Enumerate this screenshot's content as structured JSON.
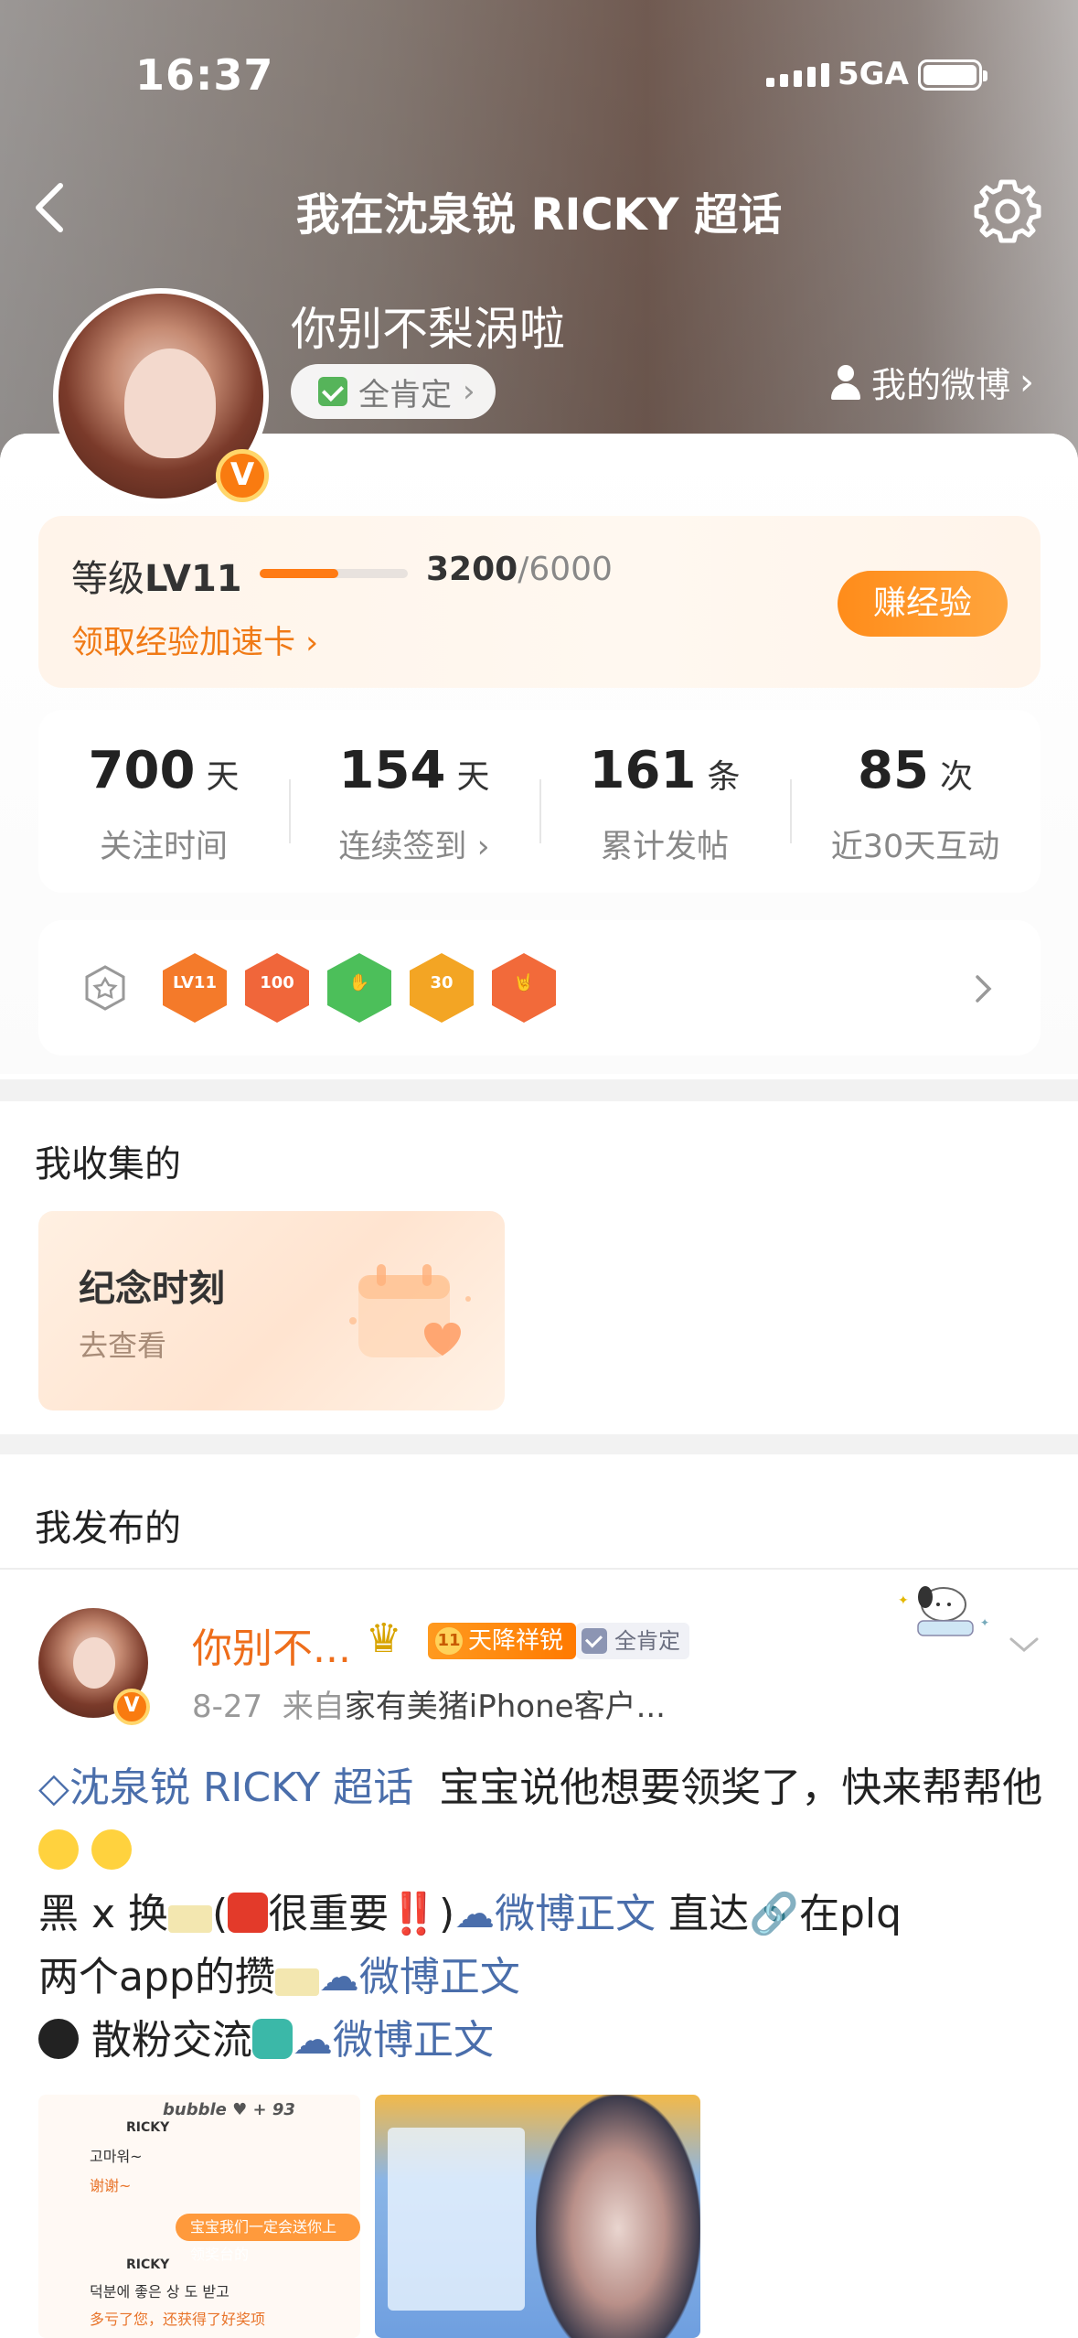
{
  "status_bar": {
    "time": "16:37",
    "network": "5GA"
  },
  "nav": {
    "title": "我在沈泉锐 RICKY 超话"
  },
  "profile": {
    "username": "你别不梨涡啦",
    "chip_label": "全肯定",
    "my_weibo": "我的微博"
  },
  "level": {
    "label_prefix": "等级",
    "level": "LV11",
    "exp_current": "3200",
    "exp_sep_max": "/6000",
    "progress_fraction": 0.53,
    "boost_link": "领取经验加速卡",
    "earn_button": "赚经验"
  },
  "stats": [
    {
      "num": "700",
      "unit": "天",
      "label": "关注时间"
    },
    {
      "num": "154",
      "unit": "天",
      "label": "连续签到"
    },
    {
      "num": "161",
      "unit": "条",
      "label": "累计发帖"
    },
    {
      "num": "85",
      "unit": "次",
      "label": "近30天互动"
    }
  ],
  "badges": [
    {
      "icon": "lv11-medal",
      "label": "LV11",
      "color": "#f47a2a"
    },
    {
      "icon": "100-days-medal",
      "label": "100",
      "color": "#f0663a"
    },
    {
      "icon": "hand-medal",
      "label": "✋",
      "color": "#4cbf5a"
    },
    {
      "icon": "30-days-medal",
      "label": "30",
      "color": "#f3a524"
    },
    {
      "icon": "rock-hand-medal",
      "label": "🤘",
      "color": "#f26a3a"
    }
  ],
  "collected": {
    "section_title": "我收集的",
    "card_title": "纪念时刻",
    "card_link": "去查看"
  },
  "published": {
    "section_title": "我发布的"
  },
  "post": {
    "author": "你别不...",
    "tag_level": "11",
    "tag_title": "天降祥锐",
    "tag_verify": "全肯定",
    "date": "8-27",
    "source_prefix": "来自",
    "source": "家有美猪iPhone客户...",
    "supertopic": "沈泉锐 RICKY 超话",
    "line1": "宝宝说他想要领奖了，快来帮帮他",
    "line2a": "黑 x 换",
    "line2b": "很重要",
    "weibo_link": "微博正文",
    "line2c": "直达",
    "line2d": "在plq",
    "line3a": "两个app的攒",
    "line4a": "散粉交流"
  },
  "thumb_chat": {
    "header": "bubble ♥ + 93",
    "name1": "RICKY",
    "msg1": "고마워~",
    "reply1": "谢谢~",
    "my_msg": "宝宝我们一定会送你上领奖台的",
    "name2": "RICKY",
    "msg2": "덕분에 좋은 상 도 받고",
    "reply2": "多亏了您，还获得了好奖项"
  },
  "colors": {
    "accent": "#ff7b14",
    "link": "#4a6eab",
    "name": "#ee6d1a"
  }
}
